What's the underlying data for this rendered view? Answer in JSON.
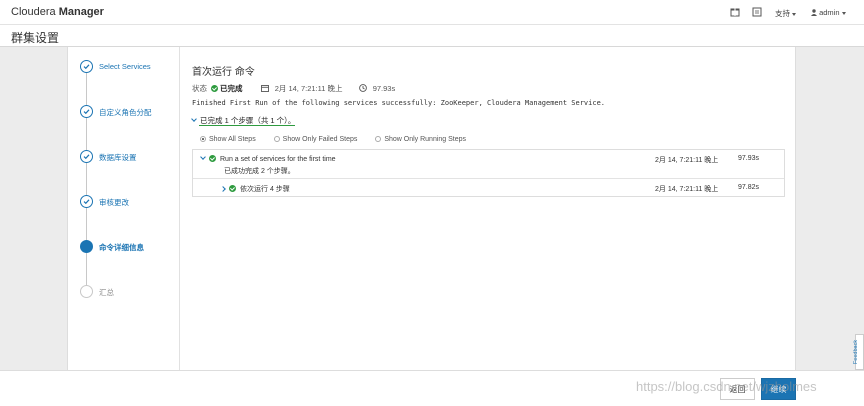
{
  "app": {
    "brand_light": "Cloudera",
    "brand_bold": "Manager",
    "nav_support": "支持",
    "nav_user": "admin"
  },
  "page": {
    "title": "群集设置"
  },
  "wizard": {
    "steps": [
      {
        "label": "Select Services",
        "state": "done"
      },
      {
        "label": "自定义角色分配",
        "state": "done"
      },
      {
        "label": "数据库设置",
        "state": "done"
      },
      {
        "label": "审核更改",
        "state": "done"
      },
      {
        "label": "命令详细信息",
        "state": "active"
      },
      {
        "label": "汇总",
        "state": "pending"
      }
    ]
  },
  "command": {
    "title": "首次运行 命令",
    "status_label": "状态",
    "status_value": "已完成",
    "date": "2月 14, 7:21:11 晚上",
    "duration": "97.93s",
    "message": "Finished First Run of the following services successfully: ZooKeeper, Cloudera Management Service.",
    "summary": "已完成 1 个步骤（共 1 个）。"
  },
  "filters": [
    {
      "label": "Show All Steps",
      "selected": true
    },
    {
      "label": "Show Only Failed Steps",
      "selected": false
    },
    {
      "label": "Show Only Running Steps",
      "selected": false
    }
  ],
  "steps_table": {
    "rows": [
      {
        "name": "Run a set of services for the first time",
        "sub": "已成功完成 2 个步骤。",
        "time": "2月 14, 7:21:11 晚上",
        "duration": "97.93s",
        "expanded": true
      },
      {
        "name": "依次运行 4 步骤",
        "time": "2月 14, 7:21:11 晚上",
        "duration": "97.82s",
        "expanded": false
      }
    ]
  },
  "footer": {
    "back_label": "返回",
    "continue_label": "继续"
  },
  "feedback_label": "Feedback",
  "watermark": "https://blog.csdn.net/wjzholmes",
  "colors": {
    "accent": "#1b74b3",
    "success": "#2e9b3f"
  }
}
